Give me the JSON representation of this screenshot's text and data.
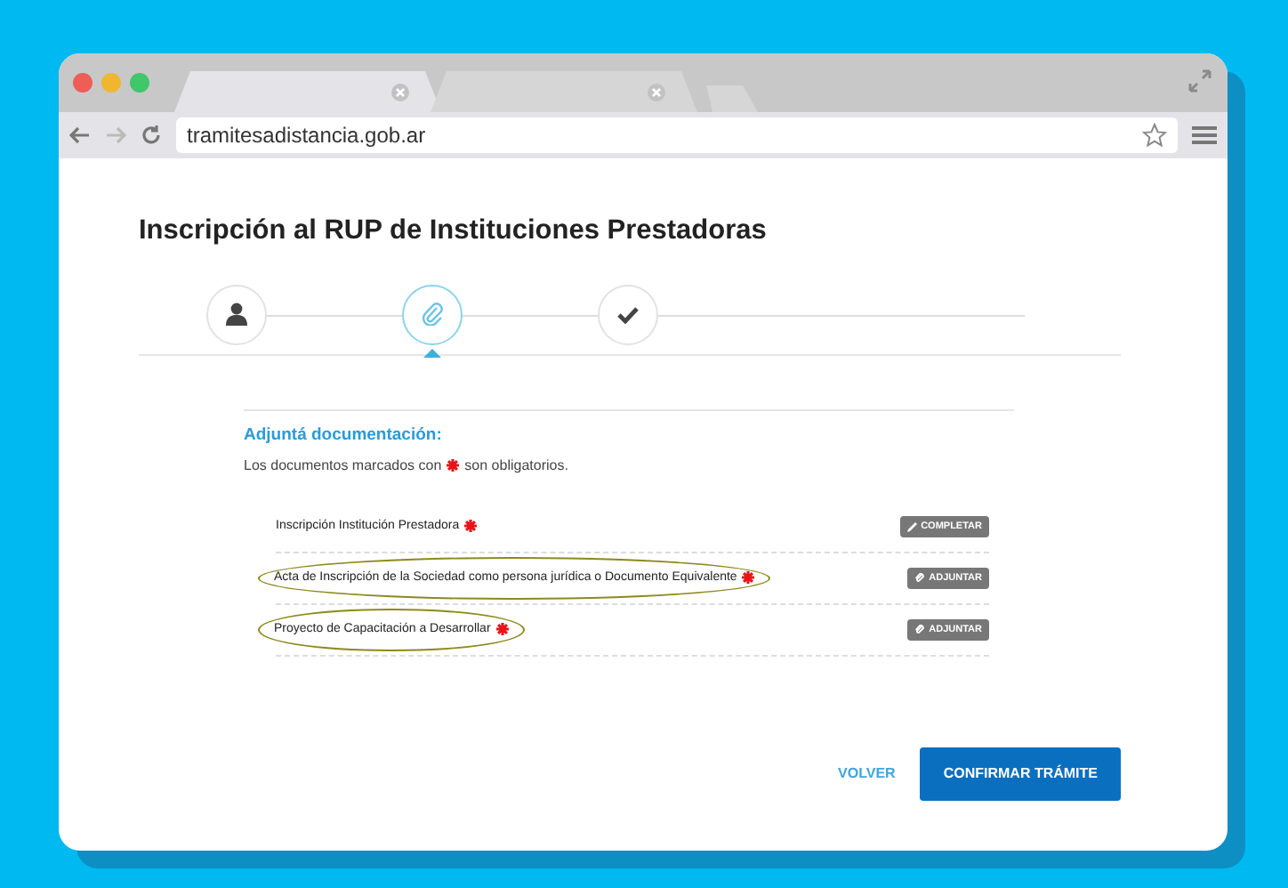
{
  "browser": {
    "tabs": [
      {
        "selected": true
      },
      {
        "selected": false
      }
    ],
    "address": "tramitesadistancia.gob.ar"
  },
  "page": {
    "title": "Inscripción al RUP de Instituciones Prestadoras",
    "steps": [
      {
        "kind": "user",
        "selected": false
      },
      {
        "kind": "attach",
        "selected": true
      },
      {
        "kind": "check",
        "selected": false
      }
    ],
    "section_title": "Adjuntá documentación:",
    "note_before": "Los documentos marcados con",
    "note_after": "son obligatorios.",
    "documents": [
      {
        "label": "Inscripción Institución Prestadora",
        "required": true,
        "highlighted": false,
        "action": {
          "kind": "edit",
          "label": "COMPLETAR"
        }
      },
      {
        "label": "Acta de Inscripción de la Sociedad como persona jurídica o Documento Equivalente",
        "required": true,
        "highlighted": true,
        "action": {
          "kind": "attach",
          "label": "ADJUNTAR"
        }
      },
      {
        "label": "Proyecto de Capacitación a Desarrollar",
        "required": true,
        "highlighted": true,
        "action": {
          "kind": "attach",
          "label": "ADJUNTAR"
        }
      }
    ],
    "back": "VOLVER",
    "confirm": "CONFIRMAR TRÁMITE"
  }
}
